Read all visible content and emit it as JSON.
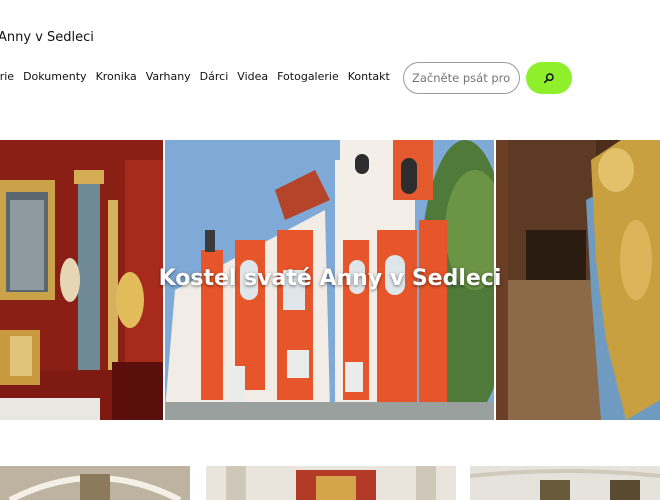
{
  "site": {
    "title": "Anny v Sedleci"
  },
  "nav": {
    "items": [
      "orie",
      "Dokumenty",
      "Kronika",
      "Varhany",
      "Dárci",
      "Videa",
      "Fotogalerie",
      "Kontakt"
    ]
  },
  "search": {
    "placeholder": "Začněte psát pro hledání"
  },
  "hero": {
    "title": "Kostel svaté Anny v Sedleci"
  },
  "colors": {
    "accent": "#8df02a"
  }
}
